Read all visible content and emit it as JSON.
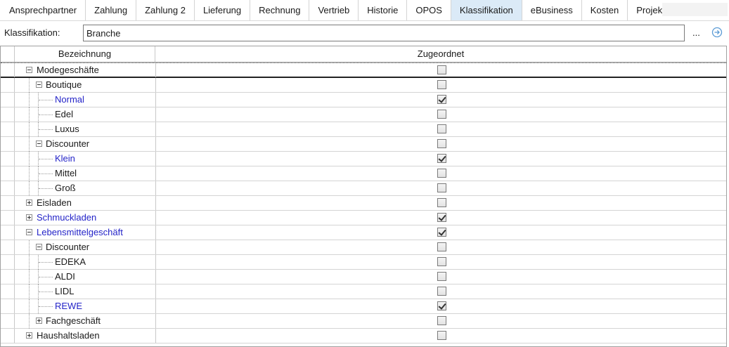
{
  "tabs": [
    {
      "label": "Ansprechpartner",
      "active": false
    },
    {
      "label": "Zahlung",
      "active": false
    },
    {
      "label": "Zahlung 2",
      "active": false
    },
    {
      "label": "Lieferung",
      "active": false
    },
    {
      "label": "Rechnung",
      "active": false
    },
    {
      "label": "Vertrieb",
      "active": false
    },
    {
      "label": "Historie",
      "active": false
    },
    {
      "label": "OPOS",
      "active": false
    },
    {
      "label": "Klassifikation",
      "active": true
    },
    {
      "label": "eBusiness",
      "active": false
    },
    {
      "label": "Kosten",
      "active": false
    },
    {
      "label": "Projek",
      "active": false
    }
  ],
  "klassifikation": {
    "label": "Klassifikation:",
    "value": "Branche",
    "browse_label": "...",
    "go_icon": "arrow-right-circle-icon"
  },
  "grid": {
    "columns": {
      "bezeichnung": "Bezeichnung",
      "zugeordnet": "Zugeordnet"
    },
    "rows": [
      {
        "name": "Modegeschäfte",
        "level": 0,
        "expander": "minus",
        "checked": false,
        "highlight": false,
        "focused": true
      },
      {
        "name": "Boutique",
        "level": 1,
        "expander": "minus",
        "checked": false,
        "highlight": false
      },
      {
        "name": "Normal",
        "level": 2,
        "expander": null,
        "checked": true,
        "highlight": true
      },
      {
        "name": "Edel",
        "level": 2,
        "expander": null,
        "checked": false,
        "highlight": false
      },
      {
        "name": "Luxus",
        "level": 2,
        "expander": null,
        "checked": false,
        "highlight": false
      },
      {
        "name": "Discounter",
        "level": 1,
        "expander": "minus",
        "checked": false,
        "highlight": false
      },
      {
        "name": "Klein",
        "level": 2,
        "expander": null,
        "checked": true,
        "highlight": true
      },
      {
        "name": "Mittel",
        "level": 2,
        "expander": null,
        "checked": false,
        "highlight": false
      },
      {
        "name": "Groß",
        "level": 2,
        "expander": null,
        "checked": false,
        "highlight": false
      },
      {
        "name": "Eisladen",
        "level": 0,
        "expander": "plus",
        "checked": false,
        "highlight": false
      },
      {
        "name": "Schmuckladen",
        "level": 0,
        "expander": "plus",
        "checked": true,
        "highlight": true
      },
      {
        "name": "Lebensmittelgeschäft",
        "level": 0,
        "expander": "minus",
        "checked": true,
        "highlight": true
      },
      {
        "name": "Discounter",
        "level": 1,
        "expander": "minus",
        "checked": false,
        "highlight": false
      },
      {
        "name": "EDEKA",
        "level": 2,
        "expander": null,
        "checked": false,
        "highlight": false
      },
      {
        "name": "ALDI",
        "level": 2,
        "expander": null,
        "checked": false,
        "highlight": false
      },
      {
        "name": "LIDL",
        "level": 2,
        "expander": null,
        "checked": false,
        "highlight": false
      },
      {
        "name": "REWE",
        "level": 2,
        "expander": null,
        "checked": true,
        "highlight": true
      },
      {
        "name": "Fachgeschäft",
        "level": 1,
        "expander": "plus",
        "checked": false,
        "highlight": false
      },
      {
        "name": "Haushaltsladen",
        "level": 0,
        "expander": "plus",
        "checked": false,
        "highlight": false
      }
    ]
  },
  "colors": {
    "active_tab": "#dbeaf7",
    "highlight_text": "#2424c8",
    "go_icon": "#5b9bd5"
  }
}
